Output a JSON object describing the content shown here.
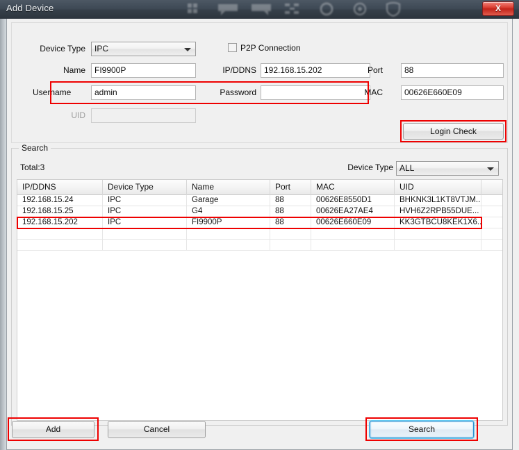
{
  "window": {
    "title": "Add Device",
    "close_label": "X",
    "watermark_icons": [
      "grid-icon",
      "speech-bubble-left-icon",
      "speech-bubble-right-icon",
      "resize-icon",
      "circle-icon",
      "target-icon",
      "shield-icon"
    ]
  },
  "form": {
    "device_type": {
      "label": "Device Type",
      "value": "IPC"
    },
    "p2p": {
      "label": "P2P Connection",
      "checked": false
    },
    "name": {
      "label": "Name",
      "value": "FI9900P"
    },
    "ip_ddns": {
      "label": "IP/DDNS",
      "value": "192.168.15.202"
    },
    "port": {
      "label": "Port",
      "value": "88"
    },
    "username": {
      "label": "Username",
      "value": "admin"
    },
    "password": {
      "label": "Password",
      "value": ""
    },
    "mac": {
      "label": "MAC",
      "value": "00626E660E09"
    },
    "uid": {
      "label": "UID",
      "value": "",
      "disabled": true
    },
    "login_check": {
      "label": "Login Check"
    }
  },
  "search": {
    "legend": "Search",
    "total": "Total:3",
    "device_type_label": "Device Type",
    "device_type_value": "ALL",
    "columns": [
      "IP/DDNS",
      "Device Type",
      "Name",
      "Port",
      "MAC",
      "UID",
      ""
    ],
    "rows": [
      [
        "192.168.15.24",
        "IPC",
        "Garage",
        "88",
        "00626E8550D1",
        "BHKNK3L1KT8VTJM...",
        ""
      ],
      [
        "192.168.15.25",
        "IPC",
        "G4",
        "88",
        "00626EA27AE4",
        "HVH6Z2RPB55DUE...",
        ""
      ],
      [
        "192.168.15.202",
        "IPC",
        "FI9900P",
        "88",
        "00626E660E09",
        "KK3GTBCU8KEK1X6...",
        ""
      ]
    ]
  },
  "footer": {
    "add": "Add",
    "cancel": "Cancel",
    "search": "Search"
  },
  "colors": {
    "annotation_red": "#ee0000",
    "focus_blue": "#63c8f0",
    "titlebar_dark": "#3e4955",
    "close_red": "#c2241a"
  }
}
